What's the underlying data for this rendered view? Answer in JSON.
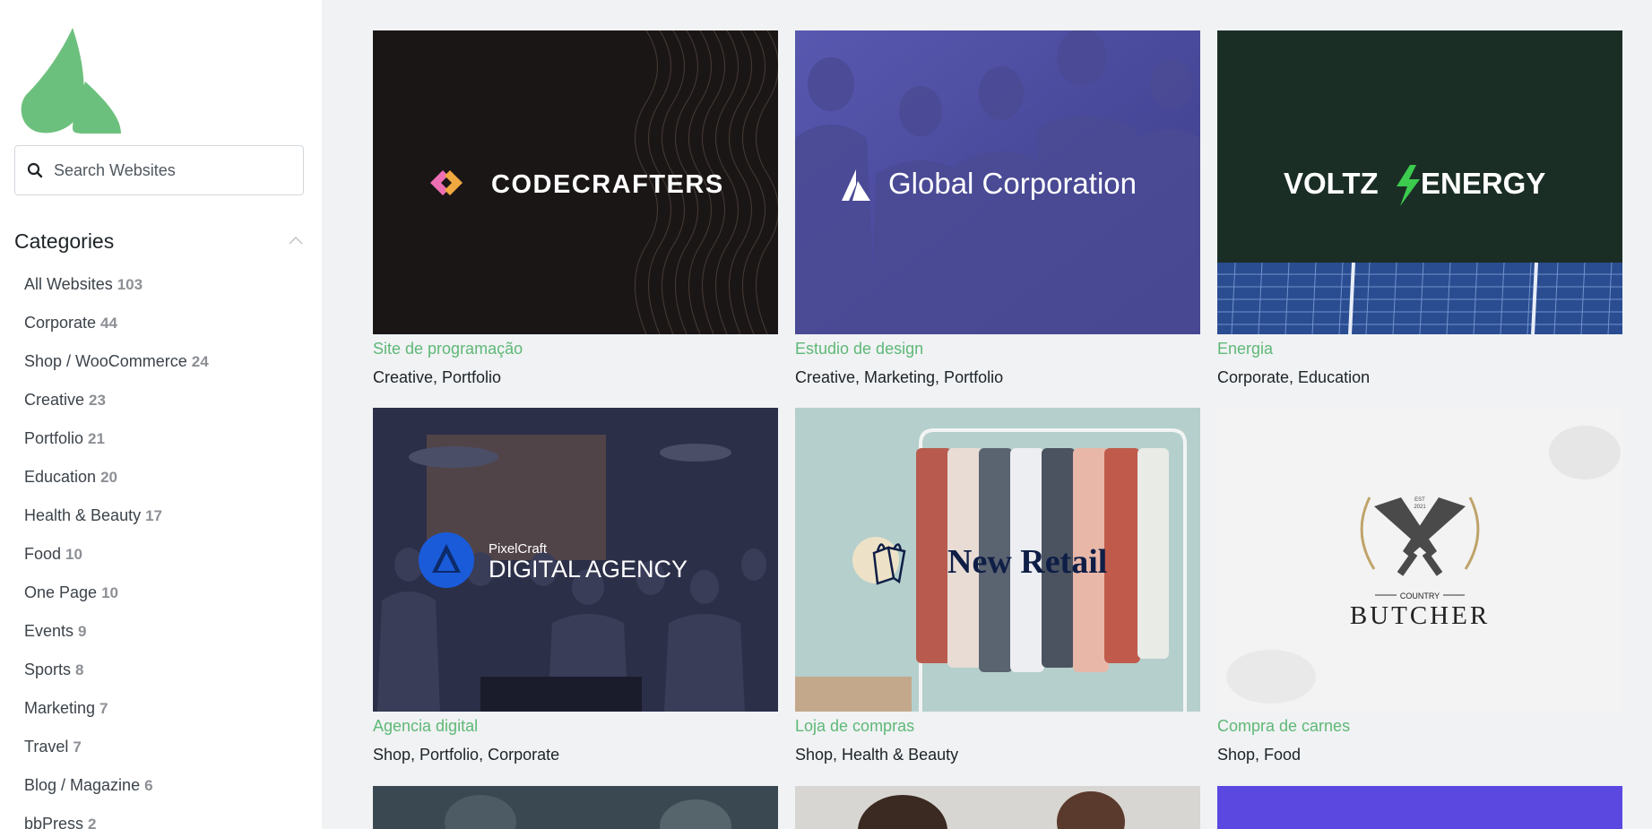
{
  "search": {
    "placeholder": "Search Websites"
  },
  "categories": {
    "title": "Categories",
    "items": [
      {
        "label": "All Websites",
        "count": "103"
      },
      {
        "label": "Corporate",
        "count": "44"
      },
      {
        "label": "Shop / WooCommerce",
        "count": "24"
      },
      {
        "label": "Creative",
        "count": "23"
      },
      {
        "label": "Portfolio",
        "count": "21"
      },
      {
        "label": "Education",
        "count": "20"
      },
      {
        "label": "Health & Beauty",
        "count": "17"
      },
      {
        "label": "Food",
        "count": "10"
      },
      {
        "label": "One Page",
        "count": "10"
      },
      {
        "label": "Events",
        "count": "9"
      },
      {
        "label": "Sports",
        "count": "8"
      },
      {
        "label": "Marketing",
        "count": "7"
      },
      {
        "label": "Travel",
        "count": "7"
      },
      {
        "label": "Blog / Magazine",
        "count": "6"
      },
      {
        "label": "bbPress",
        "count": "2"
      }
    ]
  },
  "sites": [
    {
      "title": "Site de programação",
      "categories": "Creative, Portfolio",
      "brand": "CODECRAFTERS"
    },
    {
      "title": "Estudio de design",
      "categories": "Creative, Marketing, Portfolio",
      "brand": "Global Corporation"
    },
    {
      "title": "Energia",
      "categories": "Corporate, Education",
      "brand_left": "VOLTZ",
      "brand_right": "ENERGY"
    },
    {
      "title": "Agencia digital",
      "categories": "Shop, Portfolio, Corporate",
      "brand_small": "PixelCraft",
      "brand": "DIGITAL AGENCY"
    },
    {
      "title": "Loja de compras",
      "categories": "Shop, Health & Beauty",
      "brand": "New Retail"
    },
    {
      "title": "Compra de carnes",
      "categories": "Shop, Food",
      "brand_small": "COUNTRY",
      "brand": "BUTCHER",
      "est_top": "EST",
      "est_bottom": "2021"
    }
  ],
  "colors": {
    "accent": "#5fb876",
    "brand_green": "#6cc07d"
  }
}
